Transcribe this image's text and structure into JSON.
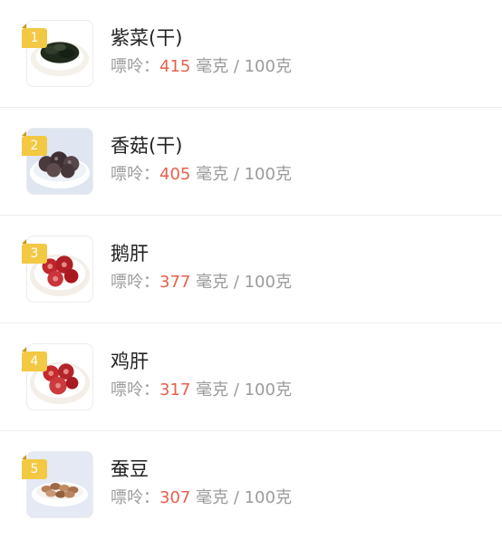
{
  "items": [
    {
      "rank": "1",
      "name": "紫菜(干)",
      "label": "嘌呤：",
      "value": "415",
      "unit": "毫克 / 100克",
      "image_icon": "seaweed-dish-icon",
      "bg_color": "#ffffff"
    },
    {
      "rank": "2",
      "name": "香菇(干)",
      "label": "嘌呤：",
      "value": "405",
      "unit": "毫克 / 100克",
      "image_icon": "dried-mushroom-dish-icon",
      "bg_color": "#dfe6f2"
    },
    {
      "rank": "3",
      "name": "鹅肝",
      "label": "嘌呤：",
      "value": "377",
      "unit": "毫克 / 100克",
      "image_icon": "goose-liver-dish-icon",
      "bg_color": "#ffffff"
    },
    {
      "rank": "4",
      "name": "鸡肝",
      "label": "嘌呤：",
      "value": "317",
      "unit": "毫克 / 100克",
      "image_icon": "chicken-liver-dish-icon",
      "bg_color": "#ffffff"
    },
    {
      "rank": "5",
      "name": "蚕豆",
      "label": "嘌呤：",
      "value": "307",
      "unit": "毫克 / 100克",
      "image_icon": "broad-bean-dish-icon",
      "bg_color": "#e4e9f4"
    }
  ],
  "colors": {
    "badge": "#f3c843",
    "value": "#e8604c",
    "meta": "#9b9b9b",
    "name": "#222222"
  }
}
